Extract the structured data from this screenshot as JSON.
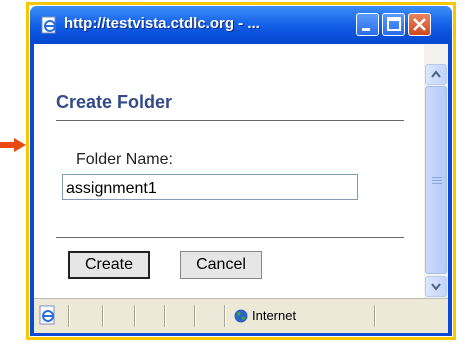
{
  "window": {
    "title": "http://testvista.ctdlc.org - ..."
  },
  "dialog": {
    "heading": "Create Folder",
    "folder_label": "Folder Name:",
    "folder_value": "assignment1",
    "create_label": "Create",
    "cancel_label": "Cancel"
  },
  "statusbar": {
    "zone_text": "Internet"
  },
  "colors": {
    "title_bar": "#0a52dc",
    "heading": "#334a8a",
    "highlight_border": "#f5c800",
    "pointer_arrow": "#e84a12"
  }
}
